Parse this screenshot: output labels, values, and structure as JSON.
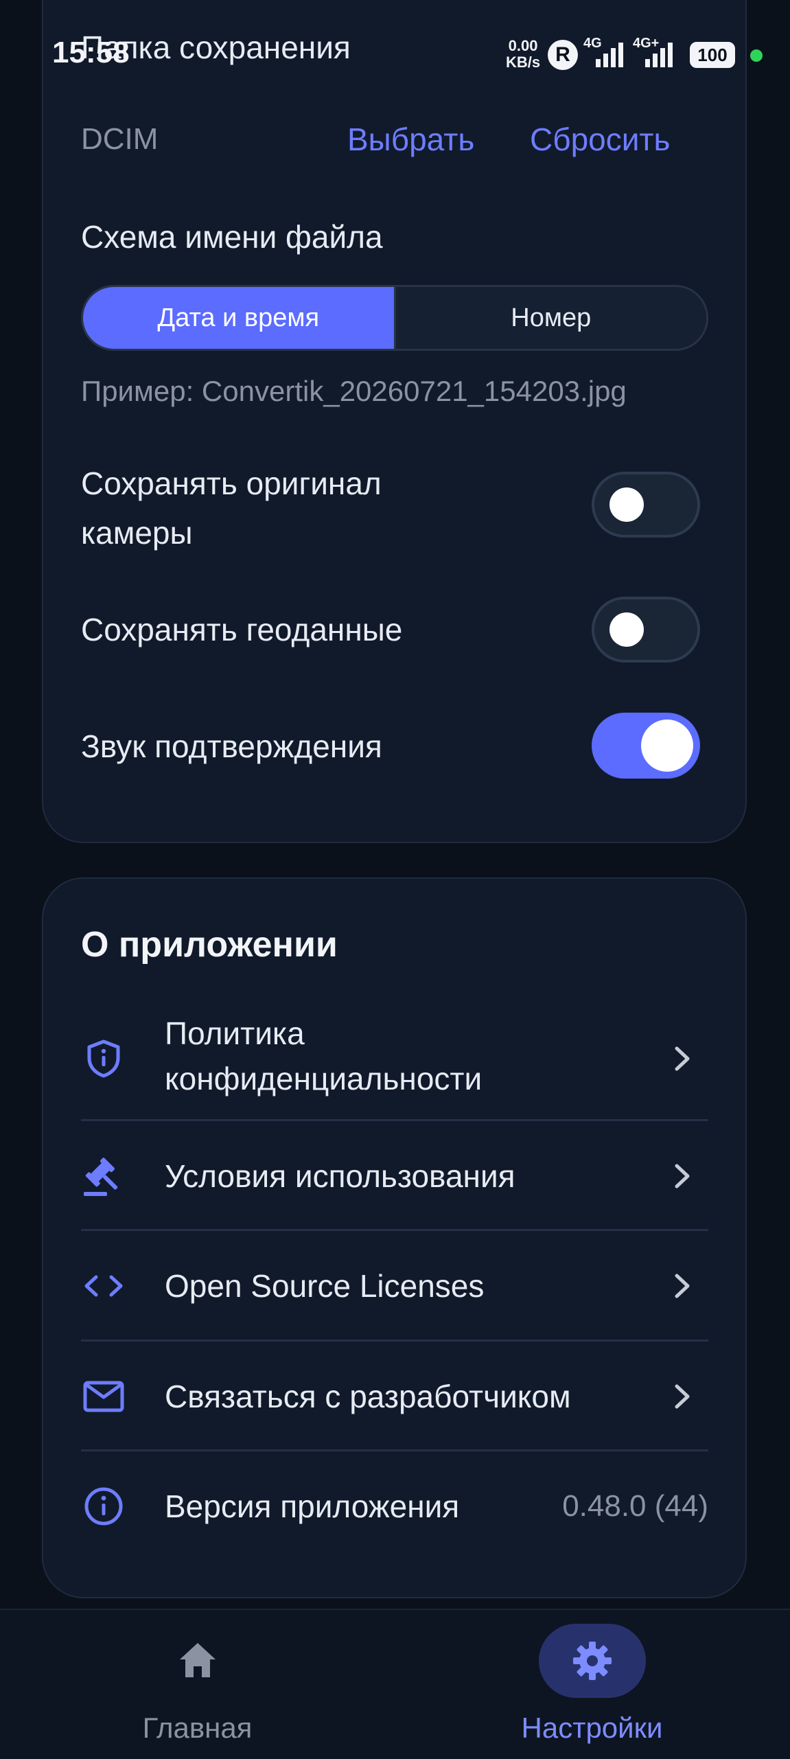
{
  "status_bar": {
    "time": "15:58",
    "net_speed_value": "0.00",
    "net_speed_unit": "KB/s",
    "roaming": "R",
    "sim1": "4G",
    "sim2": "4G+",
    "battery": "100"
  },
  "save_settings": {
    "title": "Папка сохранения",
    "folder_value": "DCIM",
    "choose_label": "Выбрать",
    "reset_label": "Сбросить",
    "filename_scheme_label": "Схема имени файла",
    "scheme_options": [
      "Дата и время",
      "Номер"
    ],
    "scheme_selected": "Дата и время",
    "example_text": "Пример: Convertik_20260721_154203.jpg",
    "toggles": [
      {
        "label_line1": "Сохранять оригинал",
        "label_line2": "камеры",
        "on": false
      },
      {
        "label": "Сохранять геоданные",
        "on": false
      },
      {
        "label": "Звук подтверждения",
        "on": true
      }
    ]
  },
  "about": {
    "title": "О приложении",
    "items": [
      {
        "label_line1": "Политика",
        "label_line2": "конфиденциальности",
        "icon": "shield-icon"
      },
      {
        "label": "Условия использования",
        "icon": "gavel-icon"
      },
      {
        "label": "Open Source Licenses",
        "icon": "code-icon"
      },
      {
        "label": "Связаться с разработчиком",
        "icon": "mail-icon"
      },
      {
        "label": "Версия приложения",
        "icon": "info-icon",
        "value": "0.48.0 (44)"
      }
    ]
  },
  "bottom_nav": {
    "items": [
      {
        "label": "Главная",
        "icon": "home-icon",
        "active": false
      },
      {
        "label": "Настройки",
        "icon": "settings-icon",
        "active": true
      }
    ]
  },
  "colors": {
    "accent": "#5b6cff",
    "background": "#0b111b",
    "card": "#111a2a"
  }
}
